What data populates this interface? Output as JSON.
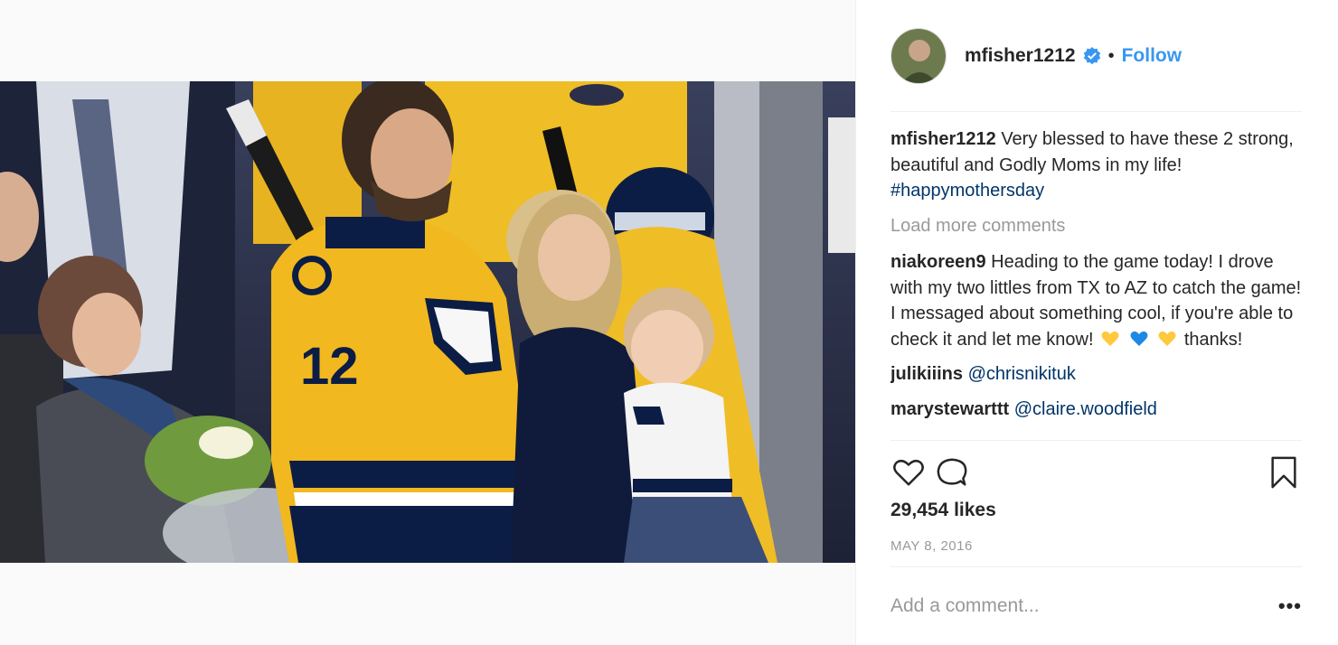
{
  "post": {
    "username": "mfisher1212",
    "follow_label": "Follow",
    "separator": "•"
  },
  "caption": {
    "user": "mfisher1212",
    "text": "Very blessed to have these 2 strong, beautiful and Godly Moms in my life!",
    "hashtag": "#happymothersday"
  },
  "load_more_label": "Load more comments",
  "comments": [
    {
      "user": "niakoreen9",
      "text_before": "Heading to the game today! I drove with my two littles from TX to AZ to catch the game! I messaged about something cool, if you're able to check it and let me know!",
      "text_after": "thanks!",
      "emoji": [
        "yellow-heart",
        "blue-heart",
        "yellow-heart"
      ]
    },
    {
      "user": "julikiiins",
      "mention": "@chrisnikituk"
    },
    {
      "user": "marystewarttt",
      "mention": "@claire.woodfield"
    }
  ],
  "likes_text": "29,454 likes",
  "date_text": "MAY 8, 2016",
  "add_comment_placeholder": "Add a comment...",
  "more_label": "•••",
  "colors": {
    "accent": "#3897f0",
    "link": "#003569",
    "muted": "#999999",
    "jersey_gold": "#f2b81f",
    "jersey_navy": "#0c1d45"
  },
  "photo": {
    "jersey_number": "12"
  }
}
